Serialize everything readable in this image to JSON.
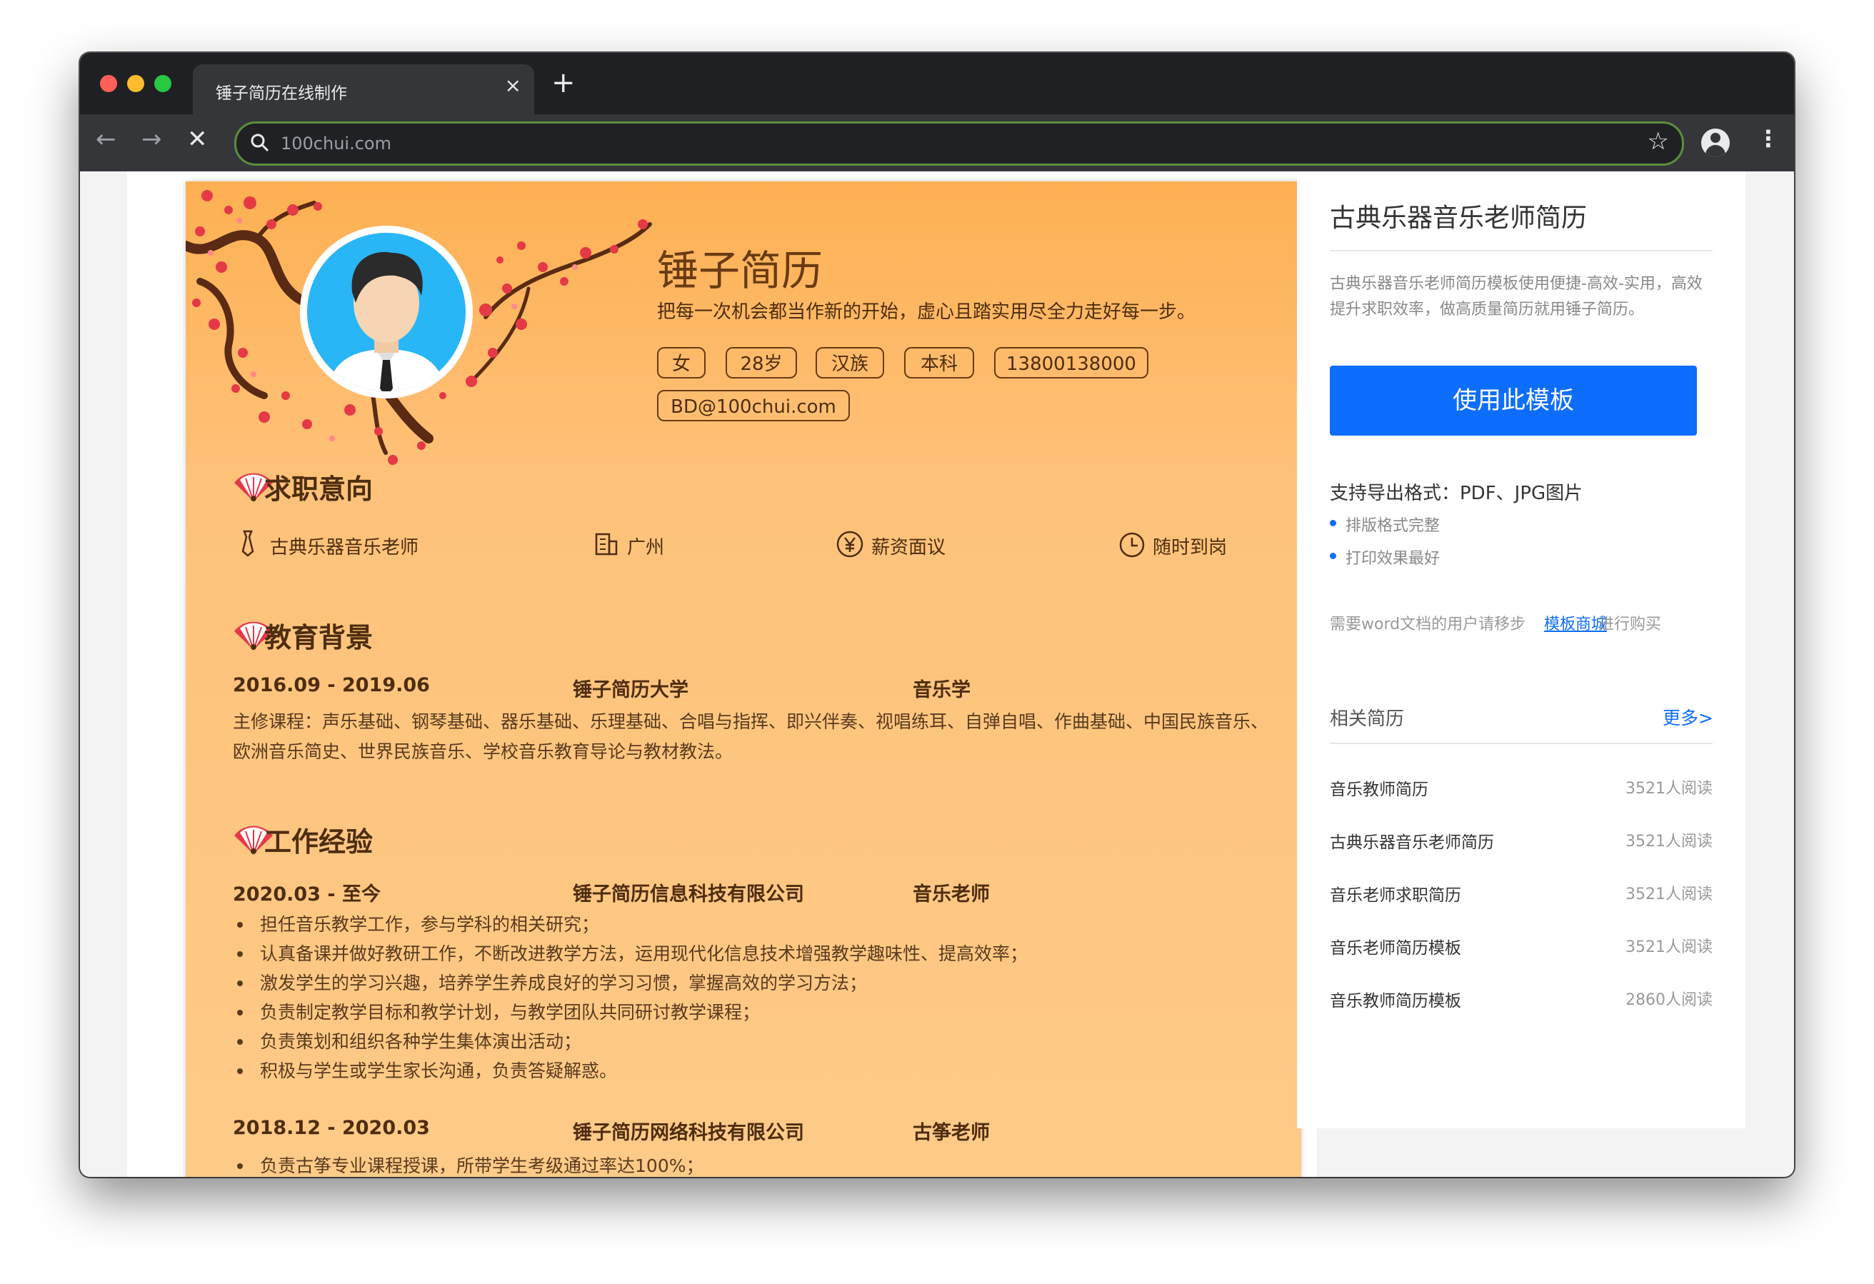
{
  "browser": {
    "tab_title": "锤子简历在线制作",
    "close_glyph": "×",
    "newtab_glyph": "+",
    "url": "100chui.com",
    "back_glyph": "←",
    "forward_glyph": "→",
    "stop_glyph": "✕",
    "star_glyph": "☆",
    "menu_glyph": "⋮"
  },
  "resume": {
    "name": "锤子简历",
    "motto": "把每一次机会都当作新的开始，虚心且踏实用尽全力走好每一步。",
    "tags": [
      "女",
      "28岁",
      "汉族",
      "本科",
      "13800138000",
      "BD@100chui.com"
    ],
    "sections": {
      "intent": {
        "title": "求职意向",
        "items": [
          "古典乐器音乐老师",
          "广州",
          "薪资面议",
          "随时到岗"
        ]
      },
      "education": {
        "title": "教育背景",
        "period": "2016.09 - 2019.06",
        "school": "锤子简历大学",
        "major": "音乐学",
        "courses": "主修课程：声乐基础、钢琴基础、器乐基础、乐理基础、合唱与指挥、即兴伴奏、视唱练耳、自弹自唱、作曲基础、中国民族音乐、欧洲音乐简史、世界民族音乐、学校音乐教育导论与教材教法。"
      },
      "work": {
        "title": "工作经验",
        "jobs": [
          {
            "period": "2020.03 - 至今",
            "company": "锤子简历信息科技有限公司",
            "position": "音乐老师",
            "duties": [
              "担任音乐教学工作，参与学科的相关研究；",
              "认真备课并做好教研工作，不断改进教学方法，运用现代化信息技术增强教学趣味性、提高效率；",
              "激发学生的学习兴趣，培养学生养成良好的学习习惯，掌握高效的学习方法；",
              "负责制定教学目标和教学计划，与教学团队共同研讨教学课程；",
              "负责策划和组织各种学生集体演出活动；",
              "积极与学生或学生家长沟通，负责答疑解惑。"
            ]
          },
          {
            "period": "2018.12 - 2020.03",
            "company": "锤子简历网络科技有限公司",
            "position": "古筝老师",
            "duties": [
              "负责古筝专业课程授课，所带学生考级通过率达100%；"
            ]
          }
        ]
      }
    }
  },
  "sidebar": {
    "title": "古典乐器音乐老师简历",
    "description": "古典乐器音乐老师简历模板使用便捷-高效-实用，高效提升求职效率，做高质量简历就用锤子简历。",
    "use_button": "使用此模板",
    "formats": "支持导出格式：PDF、JPG图片",
    "features": [
      "排版格式完整",
      "打印效果最好"
    ],
    "word_note": "需要word文档的用户请移步",
    "shop_link": "模板商城",
    "buy_note": "进行购买",
    "related_title": "相关简历",
    "more_link": "更多>",
    "related": [
      {
        "name": "音乐教师简历",
        "reads": "3521人阅读"
      },
      {
        "name": "古典乐器音乐老师简历",
        "reads": "3521人阅读"
      },
      {
        "name": "音乐老师求职简历",
        "reads": "3521人阅读"
      },
      {
        "name": "音乐老师简历模板",
        "reads": "3521人阅读"
      },
      {
        "name": "音乐教师简历模板",
        "reads": "2860人阅读"
      }
    ]
  },
  "colors": {
    "resume_top": "#fdb052",
    "resume_bottom": "#fecb88",
    "accent_brown": "#6a3b13",
    "button_blue": "#0d6efd",
    "plum_blossom": "#e63946"
  }
}
